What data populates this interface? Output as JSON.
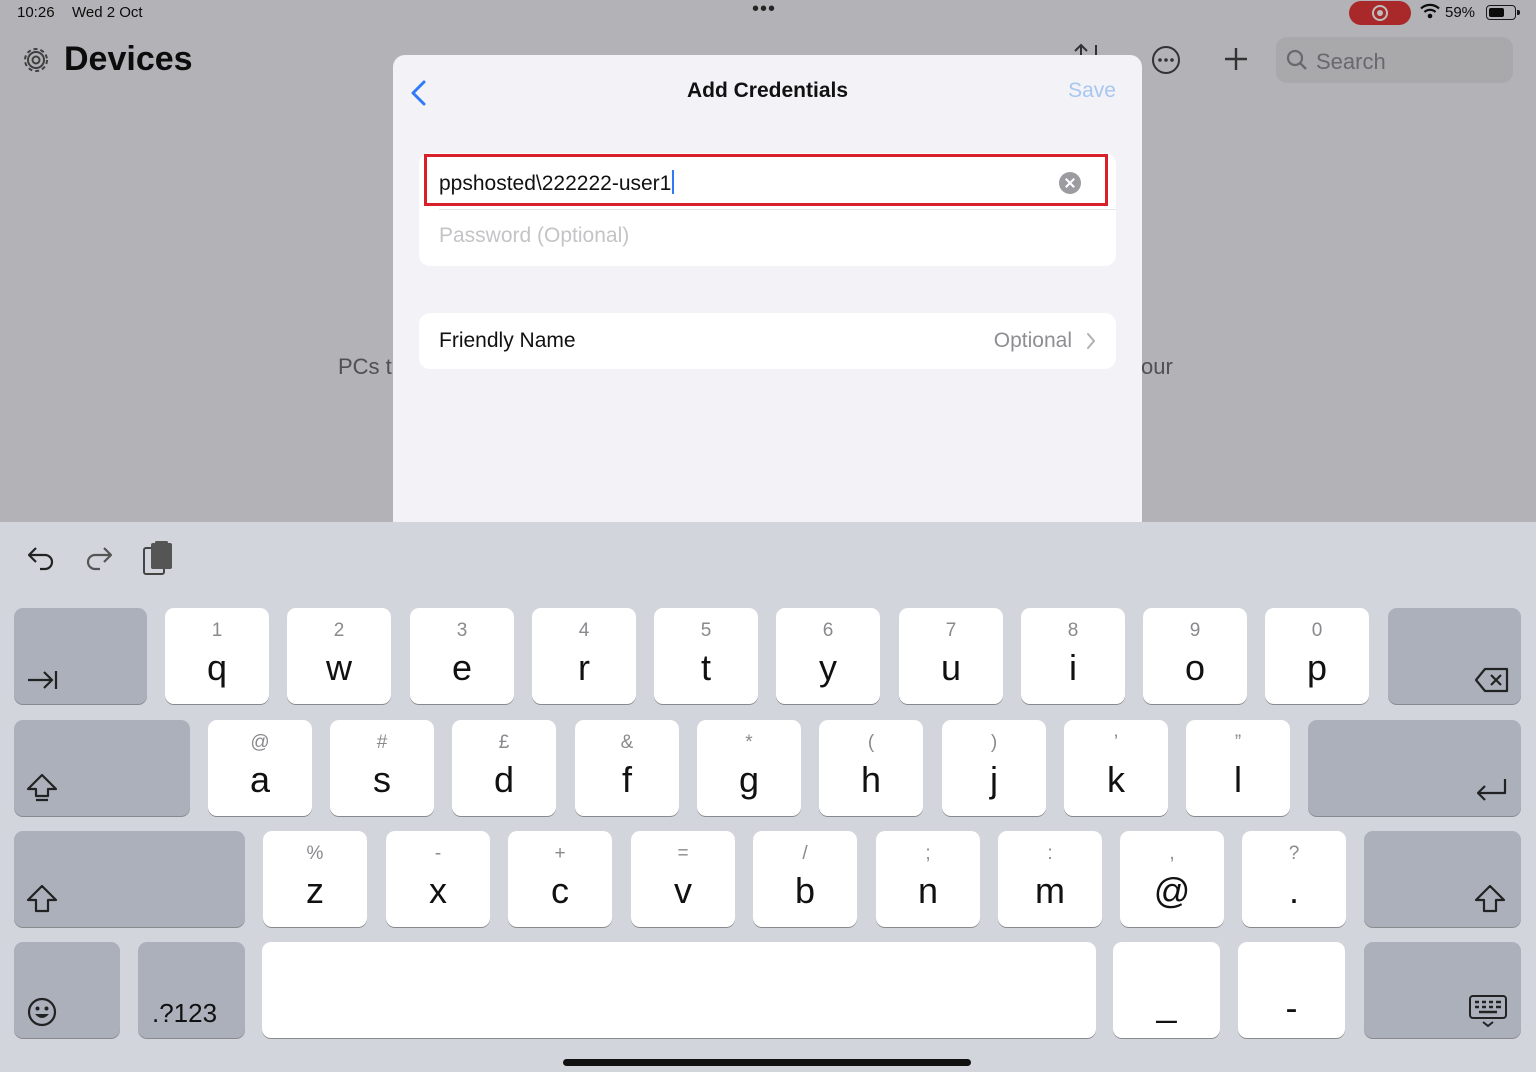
{
  "status_bar": {
    "time": "10:26",
    "date": "Wed 2 Oct",
    "battery": "59%"
  },
  "app": {
    "title": "Devices",
    "search_placeholder": "Search",
    "empty_text_left": "PCs t",
    "empty_text_right": "your"
  },
  "sheet": {
    "title": "Add Credentials",
    "save_label": "Save",
    "username_value": "ppshosted\\222222-user1",
    "password_placeholder": "Password (Optional)",
    "friendly_name_label": "Friendly Name",
    "friendly_name_value": "Optional"
  },
  "keyboard": {
    "row1": [
      {
        "sec": "1",
        "pri": "q"
      },
      {
        "sec": "2",
        "pri": "w"
      },
      {
        "sec": "3",
        "pri": "e"
      },
      {
        "sec": "4",
        "pri": "r"
      },
      {
        "sec": "5",
        "pri": "t"
      },
      {
        "sec": "6",
        "pri": "y"
      },
      {
        "sec": "7",
        "pri": "u"
      },
      {
        "sec": "8",
        "pri": "i"
      },
      {
        "sec": "9",
        "pri": "o"
      },
      {
        "sec": "0",
        "pri": "p"
      }
    ],
    "row2": [
      {
        "sec": "@",
        "pri": "a"
      },
      {
        "sec": "#",
        "pri": "s"
      },
      {
        "sec": "£",
        "pri": "d"
      },
      {
        "sec": "&",
        "pri": "f"
      },
      {
        "sec": "*",
        "pri": "g"
      },
      {
        "sec": "(",
        "pri": "h"
      },
      {
        "sec": ")",
        "pri": "j"
      },
      {
        "sec": "’",
        "pri": "k"
      },
      {
        "sec": "”",
        "pri": "l"
      }
    ],
    "row3": [
      {
        "sec": "%",
        "pri": "z"
      },
      {
        "sec": "-",
        "pri": "x"
      },
      {
        "sec": "+",
        "pri": "c"
      },
      {
        "sec": "=",
        "pri": "v"
      },
      {
        "sec": "/",
        "pri": "b"
      },
      {
        "sec": ";",
        "pri": "n"
      },
      {
        "sec": ":",
        "pri": "m"
      },
      {
        "sec": ",",
        "pri": "@"
      },
      {
        "sec": "?",
        "pri": "."
      }
    ],
    "numbers_label": ".?123",
    "underscore_label": "_",
    "hyphen_label": "-"
  },
  "icons": {
    "gear": "gear-icon",
    "sort": "sort-icon",
    "more": "more-icon",
    "add": "plus-icon",
    "search": "search-icon",
    "back": "chevron-left-icon",
    "clear": "clear-icon",
    "chevron": "chevron-right-icon",
    "undo": "undo-icon",
    "redo": "redo-icon",
    "paste": "paste-icon",
    "tab": "tab-icon",
    "delete": "delete-icon",
    "shift": "shift-icon",
    "return": "return-icon",
    "emoji": "emoji-icon",
    "hide_keyboard": "keyboard-hide-icon"
  },
  "colors": {
    "accent": "#2f7bf5",
    "save_disabled": "#a7c7ef",
    "highlight_border": "#d9202a",
    "recording": "#e5383a"
  }
}
